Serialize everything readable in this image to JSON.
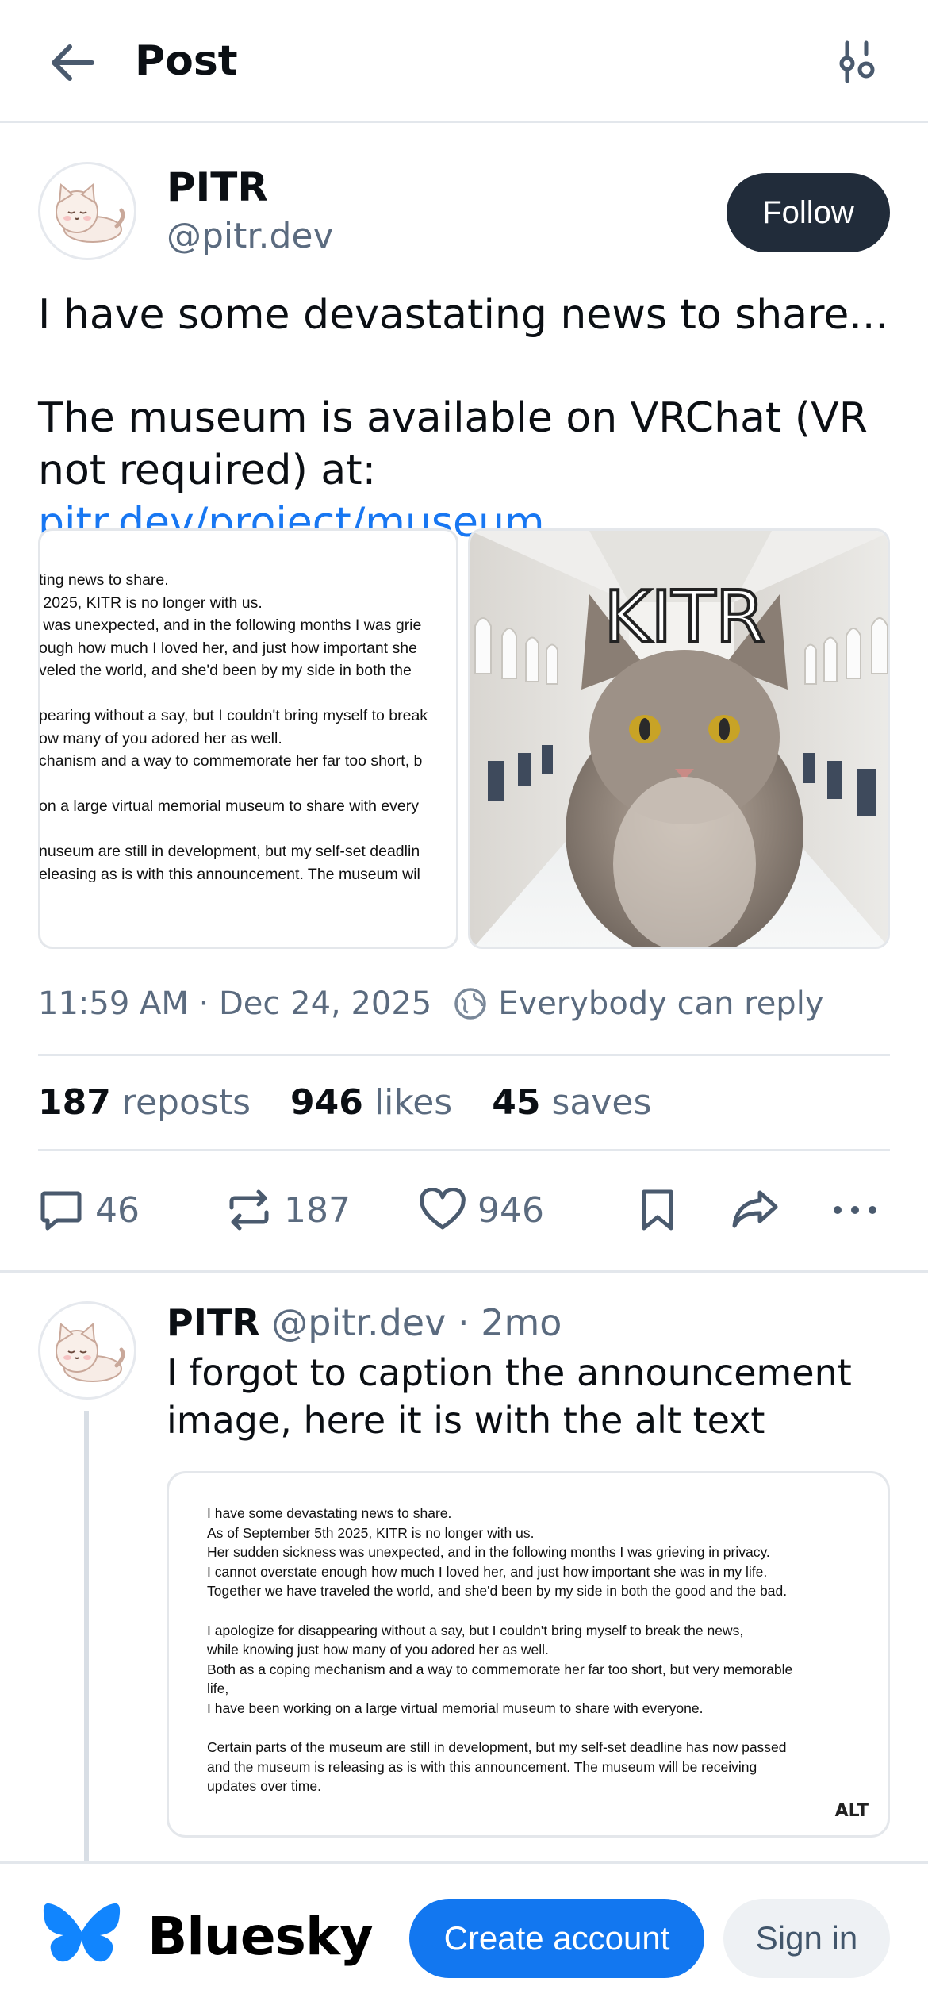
{
  "header": {
    "title": "Post"
  },
  "post": {
    "author_name": "PITR",
    "author_handle": "@pitr.dev",
    "follow_label": "Follow",
    "text_line1": "I have some devastating news to share...",
    "text_line2_prefix": "The museum is available on VRChat (VR not required) at: ",
    "link_text": "pitr.dev/project/museum",
    "image_left_text": "ting news to share.\n 2025, KITR is no longer with us.\n was unexpected, and in the following months I was grie\nough how much I loved her, and just how important she\nveled the world, and she'd been by my side in both the\n\npearing without a say, but I couldn't bring myself to break\now many of you adored her as well.\nchanism and a way to commemorate her far too short, b\n\non a large virtual memorial museum to share with every\n\nnuseum are still in development, but my self-set deadlin\neleasing as is with this announcement. The museum wil",
    "image_right_caption": "KITR",
    "timestamp": "11:59 AM · Dec 24, 2025",
    "reply_setting": "Everybody can reply",
    "stats": {
      "reposts_count": "187",
      "reposts_label": "reposts",
      "likes_count": "946",
      "likes_label": "likes",
      "saves_count": "45",
      "saves_label": "saves"
    },
    "actions": {
      "replies": "46",
      "reposts": "187",
      "likes": "946"
    }
  },
  "reply": {
    "author_name": "PITR",
    "author_handle": "@pitr.dev",
    "age": "· 2mo",
    "text": "I forgot to caption the announcement image, here it is with the alt text",
    "image_text": "I have some devastating news to share.\nAs of September 5th 2025, KITR is no longer with us.\nHer sudden sickness was unexpected, and in the following months I was grieving in privacy.\nI cannot overstate enough how much I loved her, and just how important she was in my life.\nTogether we have traveled the world, and she'd been by my side in both the good and the bad.\n\nI apologize for disappearing without a say, but I couldn't bring myself to break the news,\nwhile knowing just how many of you adored her as well.\nBoth as a coping mechanism and a way to commemorate her far too short, but very memorable\nlife,\nI have been working on a large virtual memorial museum to share with everyone.\n\nCertain parts of the museum are still in development, but my self-set deadline has now passed\nand the museum is releasing as is with this announcement. The museum will be receiving\nupdates over time.",
    "alt_badge": "ALT"
  },
  "bottom_bar": {
    "brand": "Bluesky",
    "create_account": "Create account",
    "sign_in": "Sign in"
  },
  "colors": {
    "accent": "#1277f0",
    "link": "#1877f2",
    "follow_bg": "#212c3a",
    "muted": "#5b6b7f"
  }
}
